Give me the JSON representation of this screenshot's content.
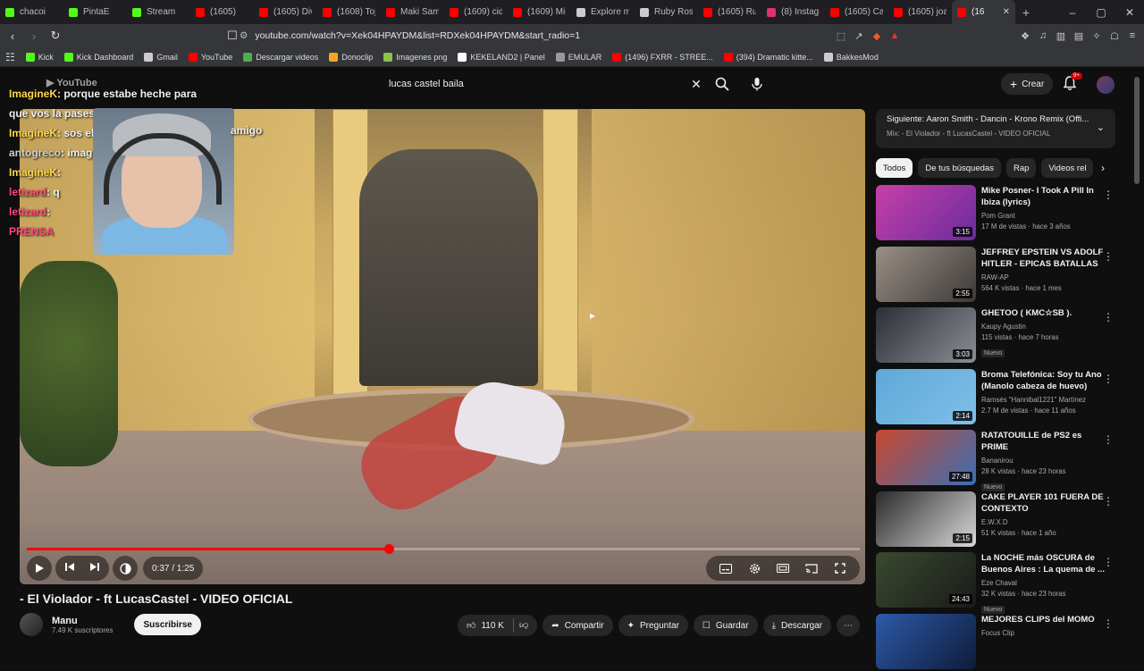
{
  "tabs": [
    {
      "label": "chacoi",
      "color": "#53fc18"
    },
    {
      "label": "PintaE",
      "color": "#53fc18"
    },
    {
      "label": "Stream",
      "color": "#53fc18"
    },
    {
      "label": "(1605)",
      "color": "#ff0000"
    },
    {
      "label": "(1605) Div",
      "color": "#ff0000"
    },
    {
      "label": "(1608) Toji",
      "color": "#ff0000"
    },
    {
      "label": "Maki Sami",
      "color": "#ff0000"
    },
    {
      "label": "(1609) cid",
      "color": "#ff0000"
    },
    {
      "label": "(1609) Mil",
      "color": "#ff0000"
    },
    {
      "label": "Explore m",
      "color": "#cccccc"
    },
    {
      "label": "Ruby Rose",
      "color": "#cccccc"
    },
    {
      "label": "(1605) Rub",
      "color": "#ff0000"
    },
    {
      "label": "(8) Instagr",
      "color": "#e1306c"
    },
    {
      "label": "(1605) Cap",
      "color": "#ff0000"
    },
    {
      "label": "(1605) joa",
      "color": "#ff0000"
    },
    {
      "label": "(16",
      "color": "#ff0000"
    }
  ],
  "address": {
    "url": "youtube.com/watch?v=Xek04HPAYDM&list=RDXek04HPAYDM&start_radio=1"
  },
  "bookmarks": [
    {
      "label": "Kick",
      "color": "#53fc18"
    },
    {
      "label": "Kick Dashboard",
      "color": "#53fc18"
    },
    {
      "label": "Gmail",
      "color": "#cccccc"
    },
    {
      "label": "YouTube",
      "color": "#ff0000"
    },
    {
      "label": "Descargar videos",
      "color": "#4caf50"
    },
    {
      "label": "Donoclip",
      "color": "#f5a623"
    },
    {
      "label": "Imagenes png",
      "color": "#8bc34a"
    },
    {
      "label": "KEKELAND2 | Panel",
      "color": "#ffffff"
    },
    {
      "label": "EMULAR",
      "color": "#999999"
    },
    {
      "label": "(1496) FXRR - STREE...",
      "color": "#ff0000"
    },
    {
      "label": "(394) Dramatic kitte...",
      "color": "#ff0000"
    },
    {
      "label": "BakkesMod",
      "color": "#cccccc"
    }
  ],
  "header": {
    "search_query": "lucas castel baila",
    "create_label": "Crear",
    "notif_count": "9+"
  },
  "overlay": {
    "chat": [
      {
        "user": "ImagineK",
        "text": ": porque estabe heche para",
        "ucolor": "#ffd84a"
      },
      {
        "user": "",
        "text": "que vos la pases mal amigo",
        "ucolor": "#ffffff"
      },
      {
        "user": "ImagineK",
        "text": ": sos el",
        "ucolor": "#ffd84a"
      },
      {
        "user": "antogreco",
        "text": ": imag",
        "ucolor": "#cfcfcf"
      },
      {
        "user": "ImagineK",
        "text": ":",
        "ucolor": "#ffd84a"
      },
      {
        "user": "letizard",
        "text": ": q",
        "ucolor": "#ff4b7a"
      },
      {
        "user": "letizard",
        "text": ": ",
        "ucolor": "#ff4b7a"
      },
      {
        "user": "PRENSA",
        "text": "",
        "ucolor": "#ff4b7a"
      }
    ],
    "chat_extra": "amigo"
  },
  "player": {
    "time": "0:37 / 1:25",
    "progress": 0.435
  },
  "video": {
    "title": "- El Violador - ft LucasCastel - VIDEO OFICIAL",
    "channel": "Manu",
    "subscribers": "7.49 K suscriptores",
    "subscribe_label": "Suscribirse",
    "likes": "110 K",
    "share_label": "Compartir",
    "ask_label": "Preguntar",
    "save_label": "Guardar",
    "download_label": "Descargar"
  },
  "sidebar": {
    "next_title": "Siguiente: Aaron Smith - Dancin - Krono Remix (Offi...",
    "next_sub": "Mix: - El Violador - ft LucasCastel - VIDEO OFICIAL",
    "chips": [
      "Todos",
      "De tus búsquedas",
      "Rap",
      "Videos rel"
    ],
    "items": [
      {
        "title": "Mike Posner- I Took A Pill In Ibiza (lyrics)",
        "channel": "Pom Grant",
        "meta": "17 M de vistas · hace 3 años",
        "duration": "3:15",
        "new": "",
        "c1": "#c83fa7",
        "c2": "#6a2c9e"
      },
      {
        "title": "JEFFREY EPSTEIN VS ADOLF HITLER - EPICAS BATALLAS D...",
        "channel": "RAW-AP",
        "meta": "564 K vistas · hace 1 mes",
        "duration": "2:55",
        "new": "",
        "c1": "#9a8f86",
        "c2": "#3d3a38"
      },
      {
        "title": "GHETOO ( KMC☆SB ).",
        "channel": "Kaupy Agustin",
        "meta": "115 vistas · hace 7 horas",
        "duration": "3:03",
        "new": "Nuevo",
        "c1": "#2b2f35",
        "c2": "#8a8f95"
      },
      {
        "title": "Broma Telefónica: Soy tu Ano (Manolo cabeza de huevo)",
        "channel": "Ramsés \"Hannibal1221\" Martínez",
        "meta": "2.7 M de vistas · hace 11 años",
        "duration": "2:14",
        "new": "",
        "c1": "#5fa8d8",
        "c2": "#7ec0e8"
      },
      {
        "title": "RATATOUILLE de PS2 es PRIME",
        "channel": "Bananirou",
        "meta": "28 K vistas · hace 23 horas",
        "duration": "27:48",
        "new": "Nuevo",
        "c1": "#c9482f",
        "c2": "#3b6fb3"
      },
      {
        "title": "CAKE PLAYER 101 FUERA DE CONTEXTO",
        "channel": "E.W.X.D",
        "meta": "51 K vistas · hace 1 año",
        "duration": "2:15",
        "new": "",
        "c1": "#2a2a2a",
        "c2": "#d9d9d9"
      },
      {
        "title": "La NOCHE más OSCURA de Buenos Aires : La quema de ...",
        "channel": "Eze Chaval",
        "meta": "32 K vistas · hace 23 horas",
        "duration": "24:43",
        "new": "Nuevo",
        "c1": "#3a4a2e",
        "c2": "#1a1a1a"
      },
      {
        "title": "MEJORES CLIPS del MOMO",
        "channel": "Focus Clip",
        "meta": "",
        "duration": "",
        "new": "",
        "c1": "#2d5aa8",
        "c2": "#0d1c3a"
      }
    ]
  }
}
